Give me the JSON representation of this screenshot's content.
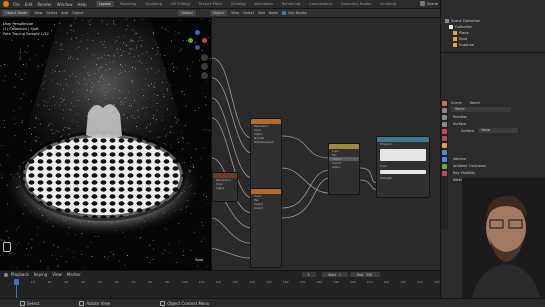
{
  "menubar": {
    "items": [
      "File",
      "Edit",
      "Render",
      "Window",
      "Help"
    ],
    "workspaces": [
      "Layout",
      "Modeling",
      "Sculpting",
      "UV Editing",
      "Texture Paint",
      "Shading",
      "Animation",
      "Rendering",
      "Compositing",
      "Geometry Nodes",
      "Scripting"
    ],
    "active_workspace": "Layout",
    "scene_label": "Scene",
    "view_layer_label": "View Layer"
  },
  "viewport_header": {
    "mode": "Object Mode",
    "menus": [
      "View",
      "Select",
      "Add",
      "Object"
    ],
    "global": "Global"
  },
  "node_header": {
    "object": "Object",
    "menus": [
      "View",
      "Select",
      "Add",
      "Node"
    ],
    "use_nodes": "Use Nodes"
  },
  "viewport": {
    "info_line1": "User Perspective",
    "info_line2": "(1) Collection | Spot",
    "info_line3": "Path Tracing Sample 1/32",
    "object_label": "Spot"
  },
  "nodes": {
    "node_a": {
      "title": "",
      "rows": [
        "Resolution",
        "Color",
        "Alpha",
        "Normal",
        "Displacement"
      ]
    },
    "node_b": {
      "title": "",
      "rows": [
        "Color",
        "Fac",
        "Color1",
        "Color2"
      ]
    },
    "node_c": {
      "title": "",
      "rows": [
        "Resolution",
        "Color",
        "Alpha"
      ]
    },
    "node_d": {
      "title": "",
      "rows": [
        "Color",
        "Fac",
        "Color1",
        "Color2",
        "Alpha"
      ]
    },
    "node_e": {
      "title": "",
      "rows": [
        "Emission",
        "Color",
        "Strength"
      ]
    }
  },
  "outliner": {
    "root": "Scene Collection",
    "items": [
      "Collection",
      "Plane",
      "Spot",
      "Suzanne"
    ]
  },
  "properties": {
    "scene": "Scene",
    "world": "World",
    "world_name": "World",
    "sections": [
      "Preview",
      "Surface",
      "Volume",
      "Ambient Occlusion",
      "Ray Visibility",
      "Settings"
    ],
    "surface_label": "Surface",
    "surface_value": "None"
  },
  "timeline": {
    "menus": [
      "Playback",
      "Keying",
      "View",
      "Marker"
    ],
    "current_frame": "1",
    "start_label": "Start",
    "start": "1",
    "end_label": "End",
    "end": "250",
    "ticks": [
      "0",
      "10",
      "20",
      "30",
      "40",
      "50",
      "60",
      "70",
      "80",
      "90",
      "100",
      "110",
      "120",
      "130",
      "140",
      "150",
      "160",
      "170",
      "180",
      "190",
      "200",
      "210",
      "220",
      "230",
      "240",
      "250"
    ]
  },
  "statusbar": {
    "select": "Select",
    "rotate": "Rotate View",
    "context": "Object Context Menu"
  }
}
